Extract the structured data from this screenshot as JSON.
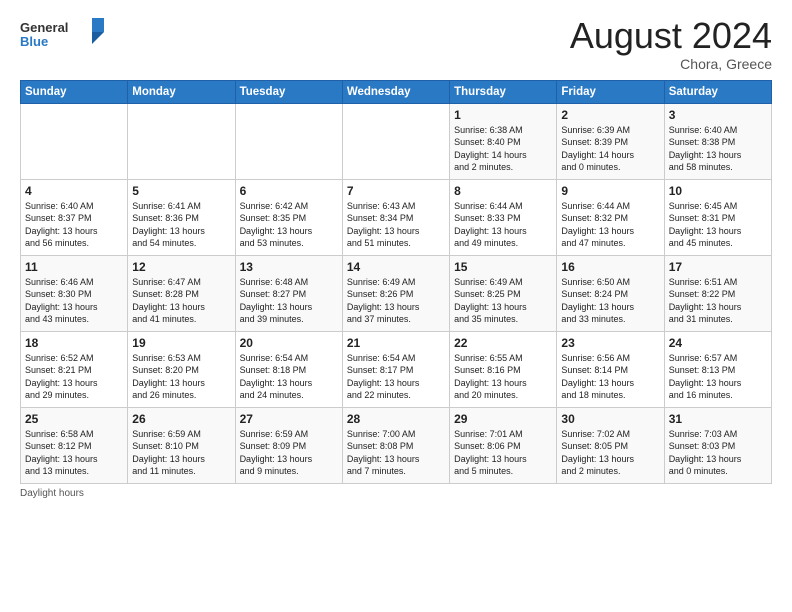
{
  "header": {
    "logo_general": "General",
    "logo_blue": "Blue",
    "month_title": "August 2024",
    "location": "Chora, Greece"
  },
  "days_of_week": [
    "Sunday",
    "Monday",
    "Tuesday",
    "Wednesday",
    "Thursday",
    "Friday",
    "Saturday"
  ],
  "weeks": [
    [
      {
        "day": "",
        "info": ""
      },
      {
        "day": "",
        "info": ""
      },
      {
        "day": "",
        "info": ""
      },
      {
        "day": "",
        "info": ""
      },
      {
        "day": "1",
        "info": "Sunrise: 6:38 AM\nSunset: 8:40 PM\nDaylight: 14 hours\nand 2 minutes."
      },
      {
        "day": "2",
        "info": "Sunrise: 6:39 AM\nSunset: 8:39 PM\nDaylight: 14 hours\nand 0 minutes."
      },
      {
        "day": "3",
        "info": "Sunrise: 6:40 AM\nSunset: 8:38 PM\nDaylight: 13 hours\nand 58 minutes."
      }
    ],
    [
      {
        "day": "4",
        "info": "Sunrise: 6:40 AM\nSunset: 8:37 PM\nDaylight: 13 hours\nand 56 minutes."
      },
      {
        "day": "5",
        "info": "Sunrise: 6:41 AM\nSunset: 8:36 PM\nDaylight: 13 hours\nand 54 minutes."
      },
      {
        "day": "6",
        "info": "Sunrise: 6:42 AM\nSunset: 8:35 PM\nDaylight: 13 hours\nand 53 minutes."
      },
      {
        "day": "7",
        "info": "Sunrise: 6:43 AM\nSunset: 8:34 PM\nDaylight: 13 hours\nand 51 minutes."
      },
      {
        "day": "8",
        "info": "Sunrise: 6:44 AM\nSunset: 8:33 PM\nDaylight: 13 hours\nand 49 minutes."
      },
      {
        "day": "9",
        "info": "Sunrise: 6:44 AM\nSunset: 8:32 PM\nDaylight: 13 hours\nand 47 minutes."
      },
      {
        "day": "10",
        "info": "Sunrise: 6:45 AM\nSunset: 8:31 PM\nDaylight: 13 hours\nand 45 minutes."
      }
    ],
    [
      {
        "day": "11",
        "info": "Sunrise: 6:46 AM\nSunset: 8:30 PM\nDaylight: 13 hours\nand 43 minutes."
      },
      {
        "day": "12",
        "info": "Sunrise: 6:47 AM\nSunset: 8:28 PM\nDaylight: 13 hours\nand 41 minutes."
      },
      {
        "day": "13",
        "info": "Sunrise: 6:48 AM\nSunset: 8:27 PM\nDaylight: 13 hours\nand 39 minutes."
      },
      {
        "day": "14",
        "info": "Sunrise: 6:49 AM\nSunset: 8:26 PM\nDaylight: 13 hours\nand 37 minutes."
      },
      {
        "day": "15",
        "info": "Sunrise: 6:49 AM\nSunset: 8:25 PM\nDaylight: 13 hours\nand 35 minutes."
      },
      {
        "day": "16",
        "info": "Sunrise: 6:50 AM\nSunset: 8:24 PM\nDaylight: 13 hours\nand 33 minutes."
      },
      {
        "day": "17",
        "info": "Sunrise: 6:51 AM\nSunset: 8:22 PM\nDaylight: 13 hours\nand 31 minutes."
      }
    ],
    [
      {
        "day": "18",
        "info": "Sunrise: 6:52 AM\nSunset: 8:21 PM\nDaylight: 13 hours\nand 29 minutes."
      },
      {
        "day": "19",
        "info": "Sunrise: 6:53 AM\nSunset: 8:20 PM\nDaylight: 13 hours\nand 26 minutes."
      },
      {
        "day": "20",
        "info": "Sunrise: 6:54 AM\nSunset: 8:18 PM\nDaylight: 13 hours\nand 24 minutes."
      },
      {
        "day": "21",
        "info": "Sunrise: 6:54 AM\nSunset: 8:17 PM\nDaylight: 13 hours\nand 22 minutes."
      },
      {
        "day": "22",
        "info": "Sunrise: 6:55 AM\nSunset: 8:16 PM\nDaylight: 13 hours\nand 20 minutes."
      },
      {
        "day": "23",
        "info": "Sunrise: 6:56 AM\nSunset: 8:14 PM\nDaylight: 13 hours\nand 18 minutes."
      },
      {
        "day": "24",
        "info": "Sunrise: 6:57 AM\nSunset: 8:13 PM\nDaylight: 13 hours\nand 16 minutes."
      }
    ],
    [
      {
        "day": "25",
        "info": "Sunrise: 6:58 AM\nSunset: 8:12 PM\nDaylight: 13 hours\nand 13 minutes."
      },
      {
        "day": "26",
        "info": "Sunrise: 6:59 AM\nSunset: 8:10 PM\nDaylight: 13 hours\nand 11 minutes."
      },
      {
        "day": "27",
        "info": "Sunrise: 6:59 AM\nSunset: 8:09 PM\nDaylight: 13 hours\nand 9 minutes."
      },
      {
        "day": "28",
        "info": "Sunrise: 7:00 AM\nSunset: 8:08 PM\nDaylight: 13 hours\nand 7 minutes."
      },
      {
        "day": "29",
        "info": "Sunrise: 7:01 AM\nSunset: 8:06 PM\nDaylight: 13 hours\nand 5 minutes."
      },
      {
        "day": "30",
        "info": "Sunrise: 7:02 AM\nSunset: 8:05 PM\nDaylight: 13 hours\nand 2 minutes."
      },
      {
        "day": "31",
        "info": "Sunrise: 7:03 AM\nSunset: 8:03 PM\nDaylight: 13 hours\nand 0 minutes."
      }
    ]
  ],
  "footer": {
    "daylight_label": "Daylight hours"
  }
}
